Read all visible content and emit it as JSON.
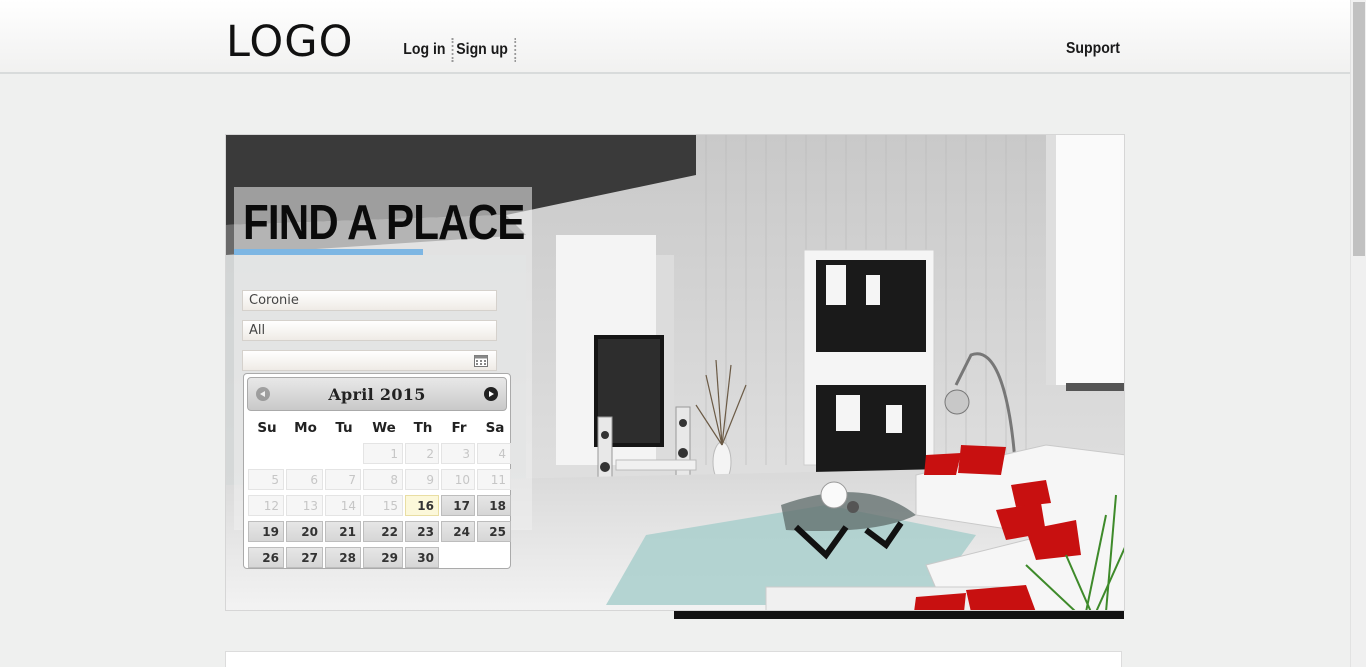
{
  "header": {
    "logo_text": "LOGO",
    "nav": [
      {
        "label": "Log in"
      },
      {
        "label": "Sign up"
      }
    ],
    "support_label": "Support"
  },
  "search_panel": {
    "title": "FIND A PLACE",
    "location_value": "Coronie",
    "type_value": "All",
    "date_value": "",
    "date_icon": "calendar-icon"
  },
  "datepicker": {
    "month_title": "April 2015",
    "prev_icon": "circle-arrow-left-icon",
    "next_icon": "circle-arrow-right-icon",
    "weekdays": [
      "Su",
      "Mo",
      "Tu",
      "We",
      "Th",
      "Fr",
      "Sa"
    ],
    "weeks": [
      [
        {
          "d": ""
        },
        {
          "d": ""
        },
        {
          "d": ""
        },
        {
          "d": "1",
          "s": "disabled"
        },
        {
          "d": "2",
          "s": "disabled"
        },
        {
          "d": "3",
          "s": "disabled"
        },
        {
          "d": "4",
          "s": "disabled"
        }
      ],
      [
        {
          "d": "5",
          "s": "disabled"
        },
        {
          "d": "6",
          "s": "disabled"
        },
        {
          "d": "7",
          "s": "disabled"
        },
        {
          "d": "8",
          "s": "disabled"
        },
        {
          "d": "9",
          "s": "disabled"
        },
        {
          "d": "10",
          "s": "disabled"
        },
        {
          "d": "11",
          "s": "disabled"
        }
      ],
      [
        {
          "d": "12",
          "s": "disabled"
        },
        {
          "d": "13",
          "s": "disabled"
        },
        {
          "d": "14",
          "s": "disabled"
        },
        {
          "d": "15",
          "s": "disabled"
        },
        {
          "d": "16",
          "s": "today"
        },
        {
          "d": "17",
          "s": "active"
        },
        {
          "d": "18",
          "s": "active"
        }
      ],
      [
        {
          "d": "19",
          "s": "active"
        },
        {
          "d": "20",
          "s": "active"
        },
        {
          "d": "21",
          "s": "active"
        },
        {
          "d": "22",
          "s": "active"
        },
        {
          "d": "23",
          "s": "active"
        },
        {
          "d": "24",
          "s": "active"
        },
        {
          "d": "25",
          "s": "active"
        }
      ],
      [
        {
          "d": "26",
          "s": "active"
        },
        {
          "d": "27",
          "s": "active"
        },
        {
          "d": "28",
          "s": "active"
        },
        {
          "d": "29",
          "s": "active"
        },
        {
          "d": "30",
          "s": "active"
        },
        {
          "d": ""
        },
        {
          "d": ""
        }
      ]
    ]
  },
  "colors": {
    "accent_rule": "#7db6e3",
    "today_bg": "#fcf8da",
    "sofa_red": "#c81010"
  }
}
